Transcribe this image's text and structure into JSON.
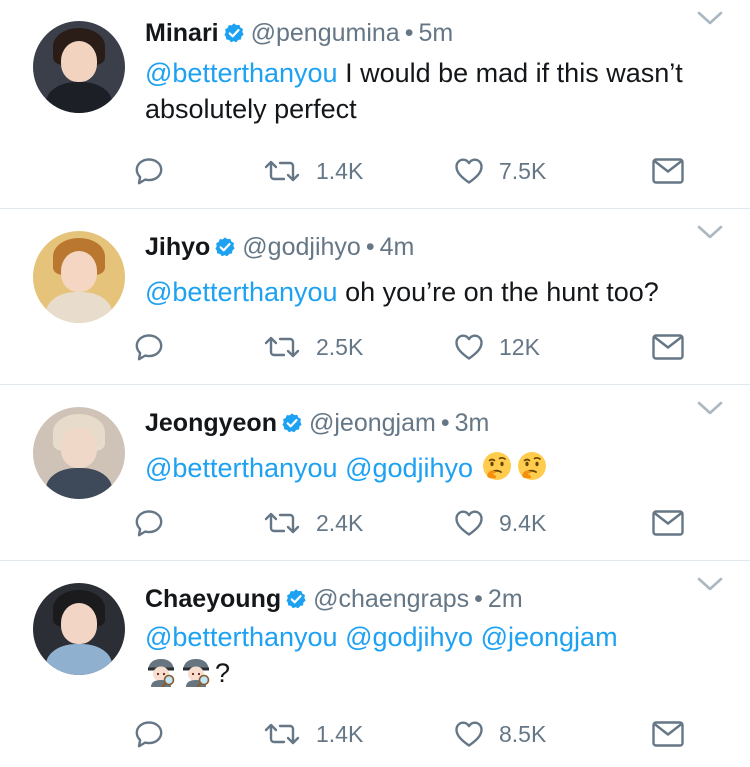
{
  "tweets": [
    {
      "name": "Minari",
      "handle": "@pengumina",
      "separator": "•",
      "time": "5m",
      "mentions": [
        "@betterthanyou"
      ],
      "text": "I would be mad if this wasn’t absolutely perfect",
      "retweets": "1.4K",
      "likes": "7.5K",
      "avatar_colors": {
        "bg": "#3a3f4a",
        "skin": "#f1d3c0",
        "hair": "#2a1d18",
        "body": "#1d1f26"
      }
    },
    {
      "name": "Jihyo",
      "handle": "@godjihyo",
      "separator": "•",
      "time": "4m",
      "mentions": [
        "@betterthanyou"
      ],
      "text": "oh you’re on the hunt too?",
      "retweets": "2.5K",
      "likes": "12K",
      "avatar_colors": {
        "bg": "#e6c37a",
        "skin": "#f4d6c3",
        "hair": "#b9772f",
        "body": "#e8dccd"
      }
    },
    {
      "name": "Jeongyeon",
      "handle": "@jeongjam",
      "separator": "•",
      "time": "3m",
      "mentions": [
        "@betterthanyou",
        "@godjihyo"
      ],
      "text": "",
      "emojis": [
        "thinking-face",
        "thinking-face"
      ],
      "retweets": "2.4K",
      "likes": "9.4K",
      "avatar_colors": {
        "bg": "#cfc3b7",
        "skin": "#f0d8c8",
        "hair": "#e7dccb",
        "body": "#3e4a5a"
      }
    },
    {
      "name": "Chaeyoung",
      "handle": "@chaengraps",
      "separator": "•",
      "time": "2m",
      "mentions": [
        "@betterthanyou",
        "@godjihyo",
        "@jeongjam"
      ],
      "text": "?",
      "emojis": [
        "detective",
        "detective"
      ],
      "retweets": "1.4K",
      "likes": "8.5K",
      "avatar_colors": {
        "bg": "#2c2e35",
        "skin": "#f2d5c4",
        "hair": "#1b1a1c",
        "body": "#8fb1cf"
      }
    }
  ],
  "colors": {
    "link": "#1da1f2",
    "muted": "#657786",
    "text": "#14171a",
    "divider": "#e1e8ed"
  },
  "icons": [
    "verified-badge-icon",
    "reply-icon",
    "retweet-icon",
    "like-icon",
    "direct-message-icon",
    "chevron-down-icon"
  ]
}
